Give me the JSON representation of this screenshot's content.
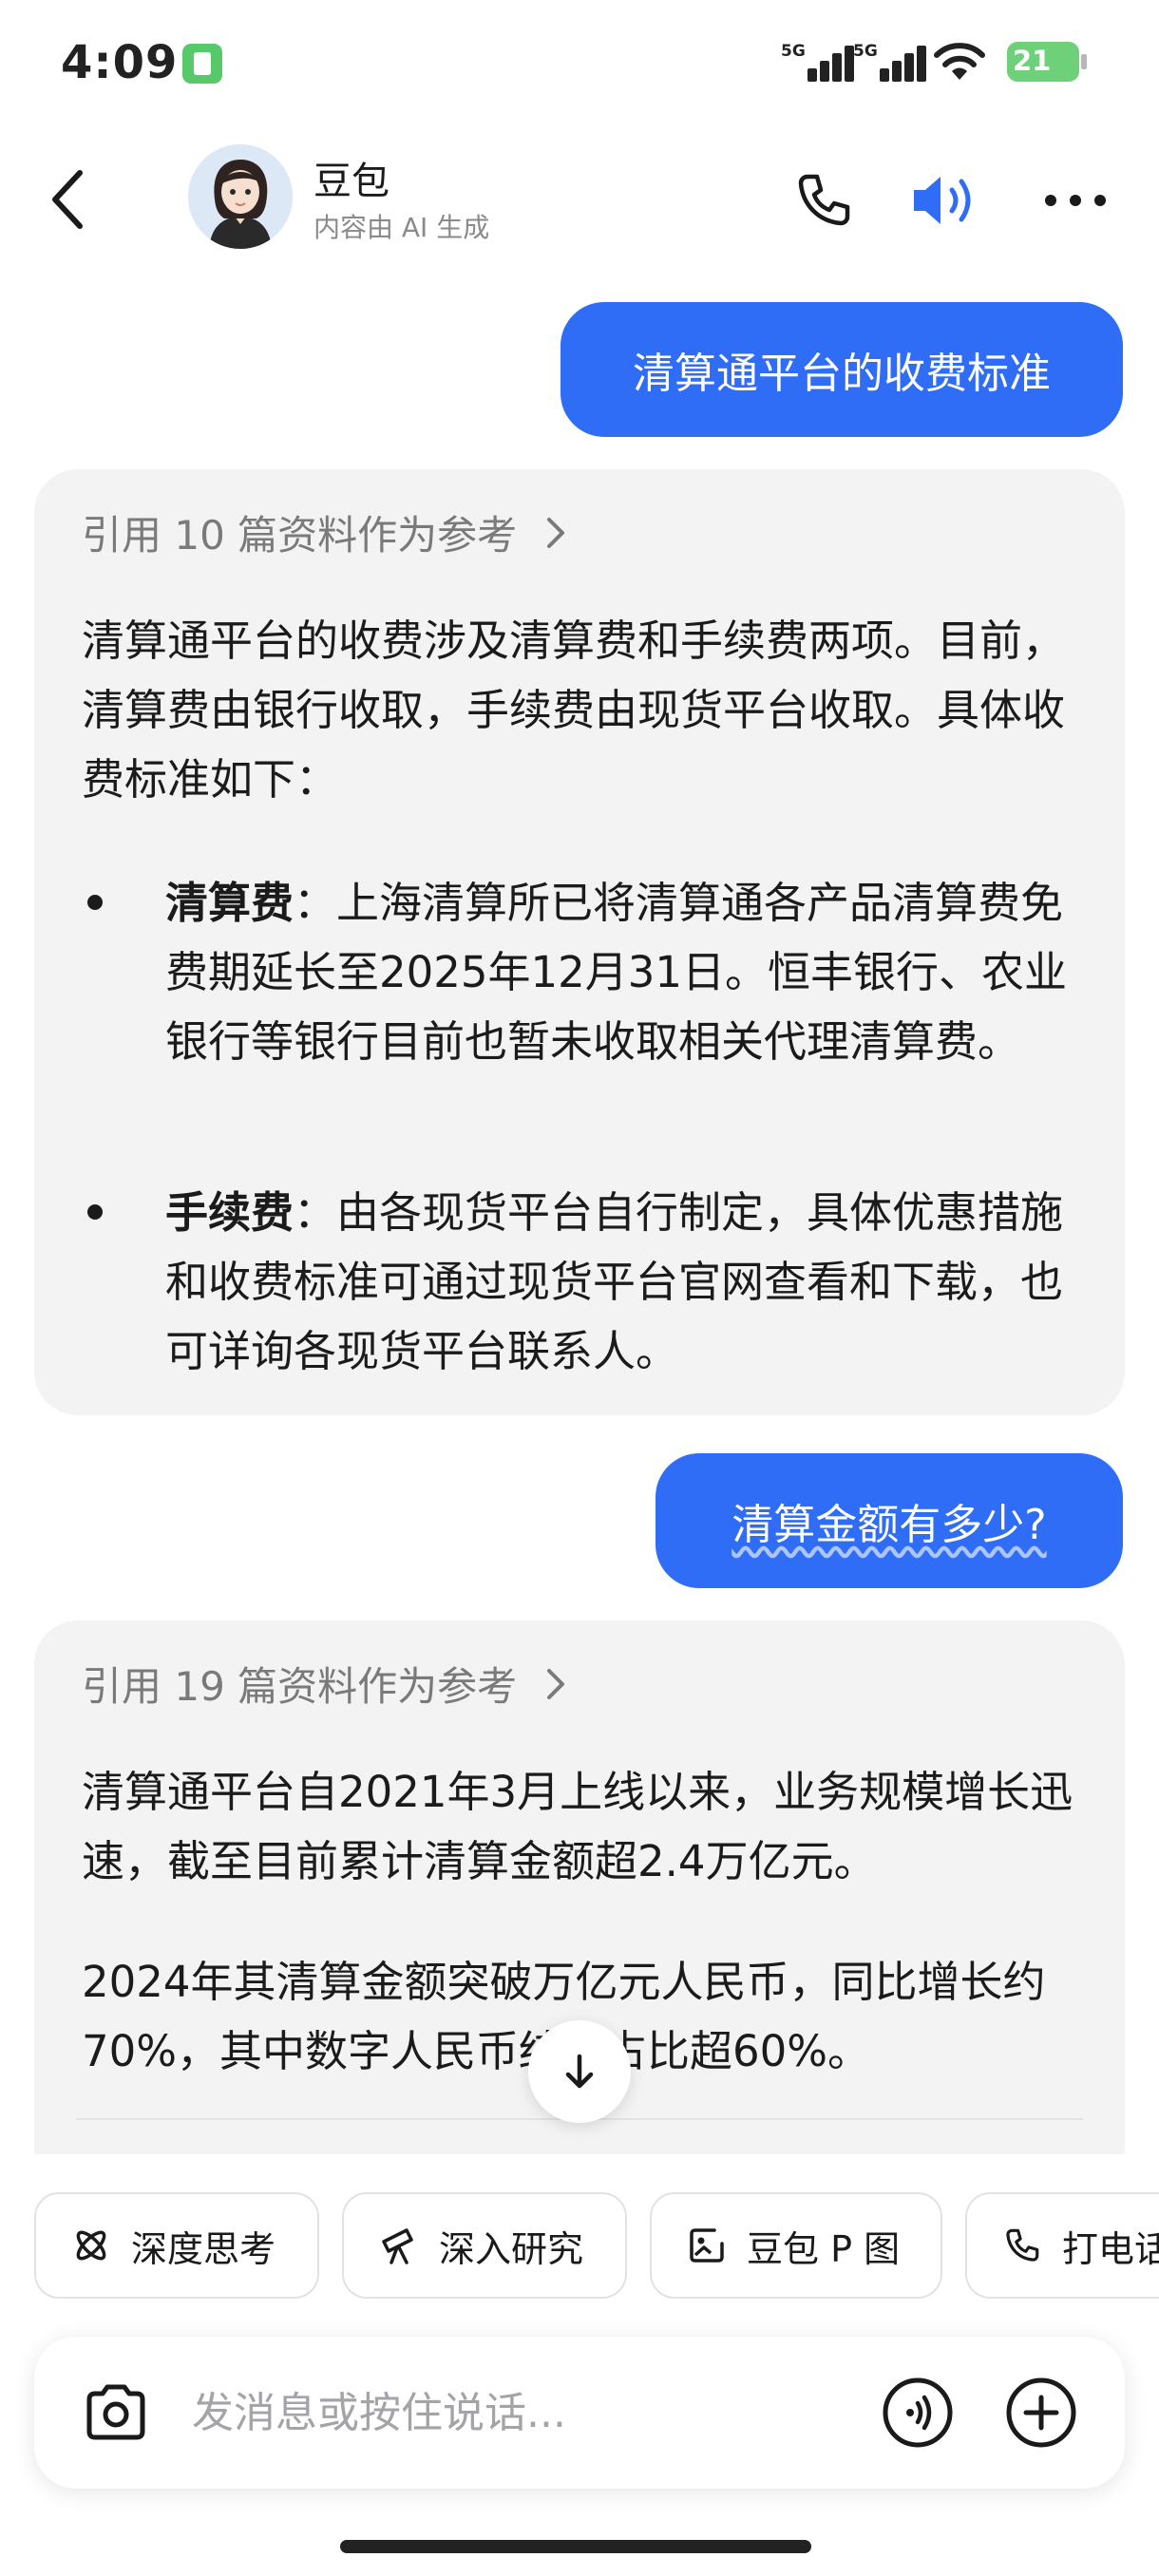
{
  "status_bar": {
    "time": "4:09",
    "signal_1": "5G",
    "signal_2": "5G",
    "battery": "21"
  },
  "header": {
    "bot_name": "豆包",
    "subtitle": "内容由 AI 生成"
  },
  "conversation": {
    "q1": "清算通平台的收费标准",
    "a1": {
      "references": "引用 10 篇资料作为参考",
      "intro": "清算通平台的收费涉及清算费和手续费两项。目前，清算费由银行收取，手续费由现货平台收取。具体收费标准如下：",
      "bullet1_term": "清算费",
      "bullet1_text": "：上海清算所已将清算通各产品清算费免费期延长至2025年12月31日。恒丰银行、农业银行等银行目前也暂未收取相关代理清算费。",
      "bullet2_term": "手续费",
      "bullet2_text": "：由各现货平台自行制定，具体优惠措施和收费标准可通过现货平台官网查看和下载，也可详询各现货平台联系人。"
    },
    "q2": "清算金额有多少?",
    "a2": {
      "references": "引用 19 篇资料作为参考",
      "p1": "清算通平台自2021年3月上线以来，业务规模增长迅速，截至目前累计清算金额超2.4万亿元。",
      "p2": "2024年其清算金额突破万亿元人民币，同比增长约70%，其中数字人民币结算占比超60%。"
    }
  },
  "toolbar": {
    "chips": [
      "深度思考",
      "深入研究",
      "豆包 P 图",
      "打电话"
    ]
  },
  "composer": {
    "placeholder": "发消息或按住说话..."
  },
  "colors": {
    "accent": "#2f6df6",
    "card_bg": "#f3f3f4"
  }
}
